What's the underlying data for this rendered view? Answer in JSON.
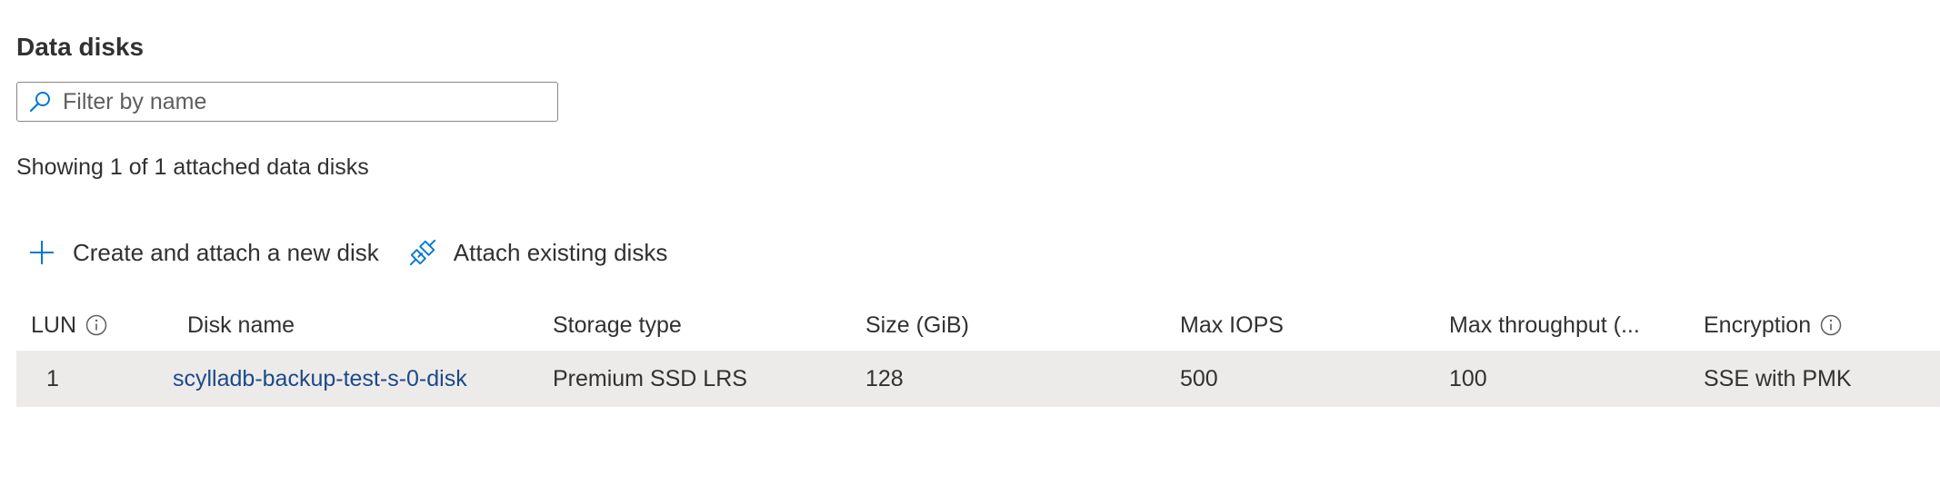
{
  "section": {
    "title": "Data disks"
  },
  "filter": {
    "placeholder": "Filter by name",
    "value": ""
  },
  "summary": {
    "text": "Showing 1 of 1 attached data disks"
  },
  "toolbar": {
    "create_label": "Create and attach a new disk",
    "attach_label": "Attach existing disks"
  },
  "table": {
    "headers": {
      "lun": "LUN",
      "disk_name": "Disk name",
      "storage_type": "Storage type",
      "size": "Size (GiB)",
      "max_iops": "Max IOPS",
      "max_throughput": "Max throughput (...",
      "encryption": "Encryption"
    },
    "rows": [
      {
        "lun": "1",
        "disk_name": "scylladb-backup-test-s-0-disk",
        "storage_type": "Premium SSD LRS",
        "size": "128",
        "max_iops": "500",
        "max_throughput": "100",
        "encryption": "SSE with PMK"
      }
    ]
  },
  "colors": {
    "accent": "#0078d4",
    "link": "#1b4a8a",
    "row_bg": "#edebe9",
    "text": "#323130"
  },
  "icons": {
    "filter": "search-icon",
    "create": "plus-icon",
    "attach": "plug-icon",
    "info": "info-icon"
  }
}
